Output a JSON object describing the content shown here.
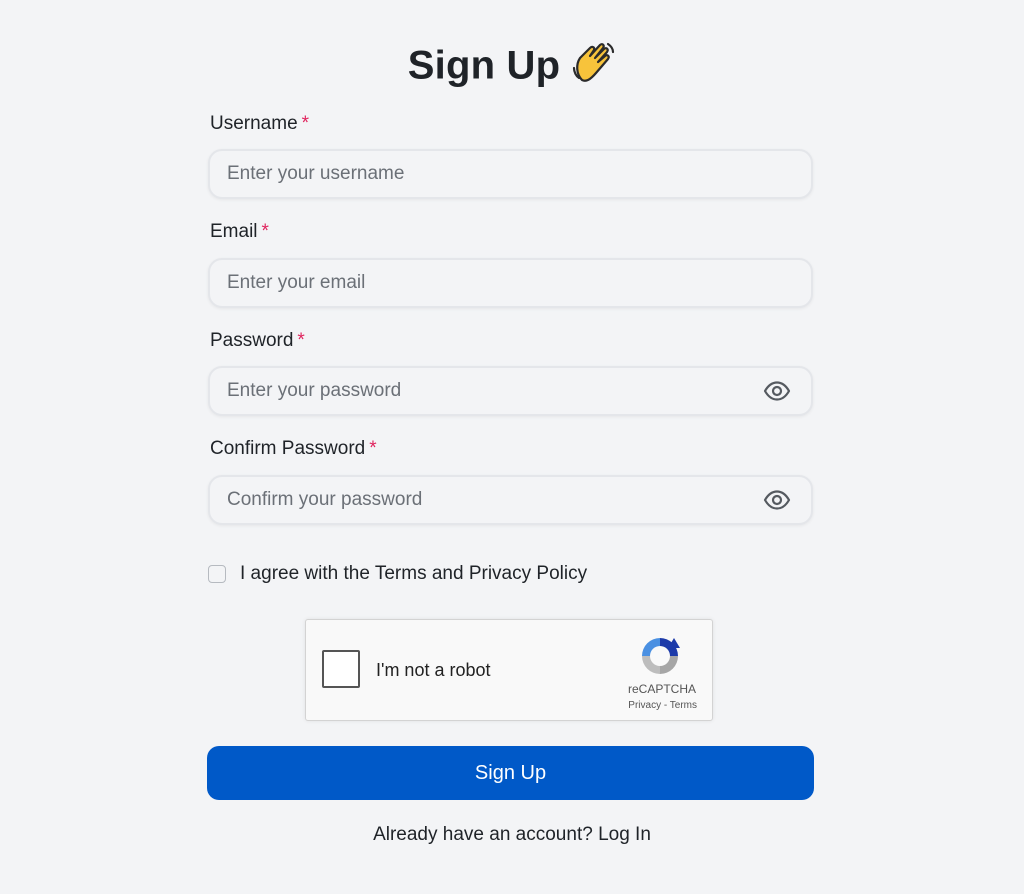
{
  "page": {
    "title": "Sign Up",
    "title_emoji": "waving-hand-icon"
  },
  "form": {
    "username": {
      "label": "Username",
      "required_mark": "*",
      "placeholder": "Enter your username",
      "value": ""
    },
    "email": {
      "label": "Email",
      "required_mark": "*",
      "placeholder": "Enter your email",
      "value": ""
    },
    "password": {
      "label": "Password",
      "required_mark": "*",
      "placeholder": "Enter your password",
      "value": "",
      "toggle_icon": "eye-icon"
    },
    "confirm_password": {
      "label": "Confirm Password",
      "required_mark": "*",
      "placeholder": "Confirm your password",
      "value": "",
      "toggle_icon": "eye-icon"
    },
    "agree": {
      "label": "I agree with the Terms  and Privacy Policy",
      "checked": false
    }
  },
  "captcha": {
    "label": "I'm not a robot",
    "brand": "reCAPTCHA",
    "links": "Privacy - Terms",
    "checked": false
  },
  "submit": {
    "label": "Sign Up"
  },
  "footer": {
    "prompt": "Already have an account?",
    "link": "Log In"
  },
  "colors": {
    "background": "#f3f4f6",
    "primary_button": "#0059c8",
    "required": "#e0245e"
  }
}
